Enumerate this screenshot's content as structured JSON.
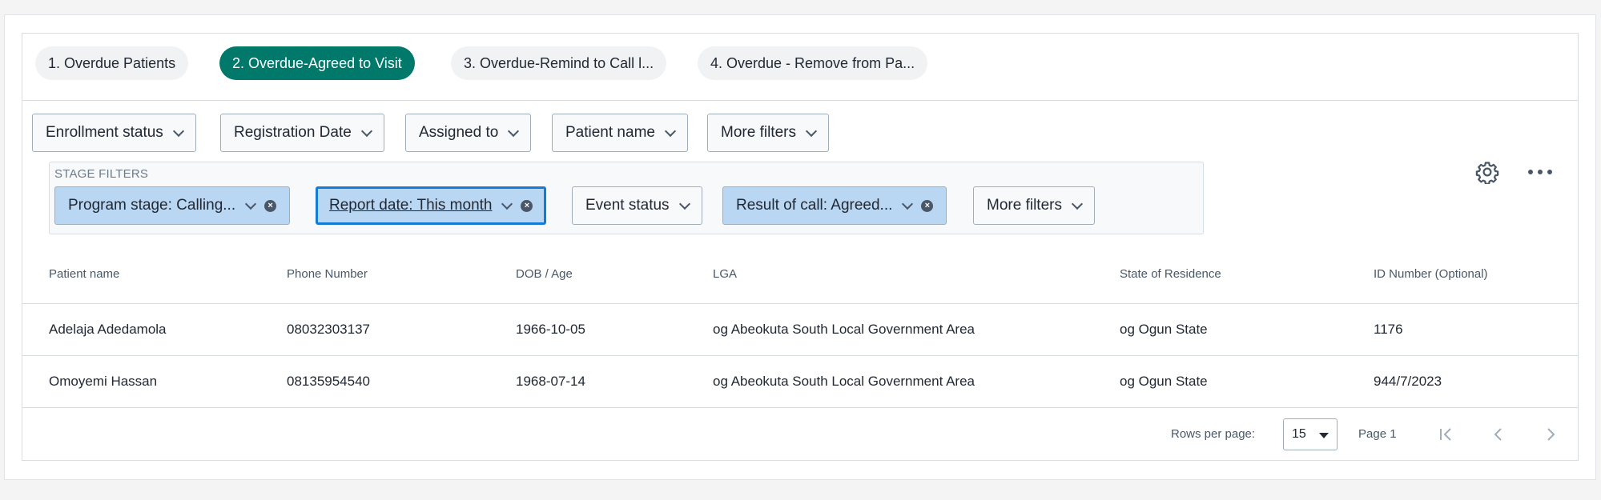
{
  "tabs": [
    {
      "label": "1. Overdue Patients"
    },
    {
      "label": "2. Overdue-Agreed to Visit"
    },
    {
      "label": "3. Overdue-Remind to Call l..."
    },
    {
      "label": "4. Overdue - Remove from Pa..."
    }
  ],
  "filters": [
    {
      "label": "Enrollment status"
    },
    {
      "label": "Registration Date"
    },
    {
      "label": "Assigned to"
    },
    {
      "label": "Patient name"
    },
    {
      "label": "More filters"
    }
  ],
  "stage_filters": {
    "label": "STAGE FILTERS",
    "items": [
      {
        "label": "Program stage: Calling..."
      },
      {
        "label": "Report date: This month"
      },
      {
        "label": "Event status"
      },
      {
        "label": "Result of call: Agreed..."
      },
      {
        "label": "More filters"
      }
    ]
  },
  "icons": {
    "settings": "gear-icon",
    "more": "more-horizontal-icon",
    "clear": "close-circle-icon",
    "dropdown": "chevron-down-icon"
  },
  "table": {
    "columns": [
      "Patient name",
      "Phone Number",
      "DOB / Age",
      "LGA",
      "State of Residence",
      "ID Number (Optional)"
    ],
    "rows": [
      [
        "Adelaja Adedamola",
        "08032303137",
        "1966-10-05",
        "og Abeokuta South Local Government Area",
        "og Ogun State",
        "1176"
      ],
      [
        "Omoyemi Hassan",
        "08135954540",
        "1968-07-14",
        "og Abeokuta South Local Government Area",
        "og Ogun State",
        "944/7/2023"
      ]
    ]
  },
  "footer": {
    "rows_per_page_label": "Rows per page:",
    "rows_per_page_value": "15",
    "page_label": "Page 1"
  },
  "colors": {
    "active_tab": "#00796b",
    "applied_filter": "#b9d6f2",
    "focus_border": "#147cd7"
  }
}
